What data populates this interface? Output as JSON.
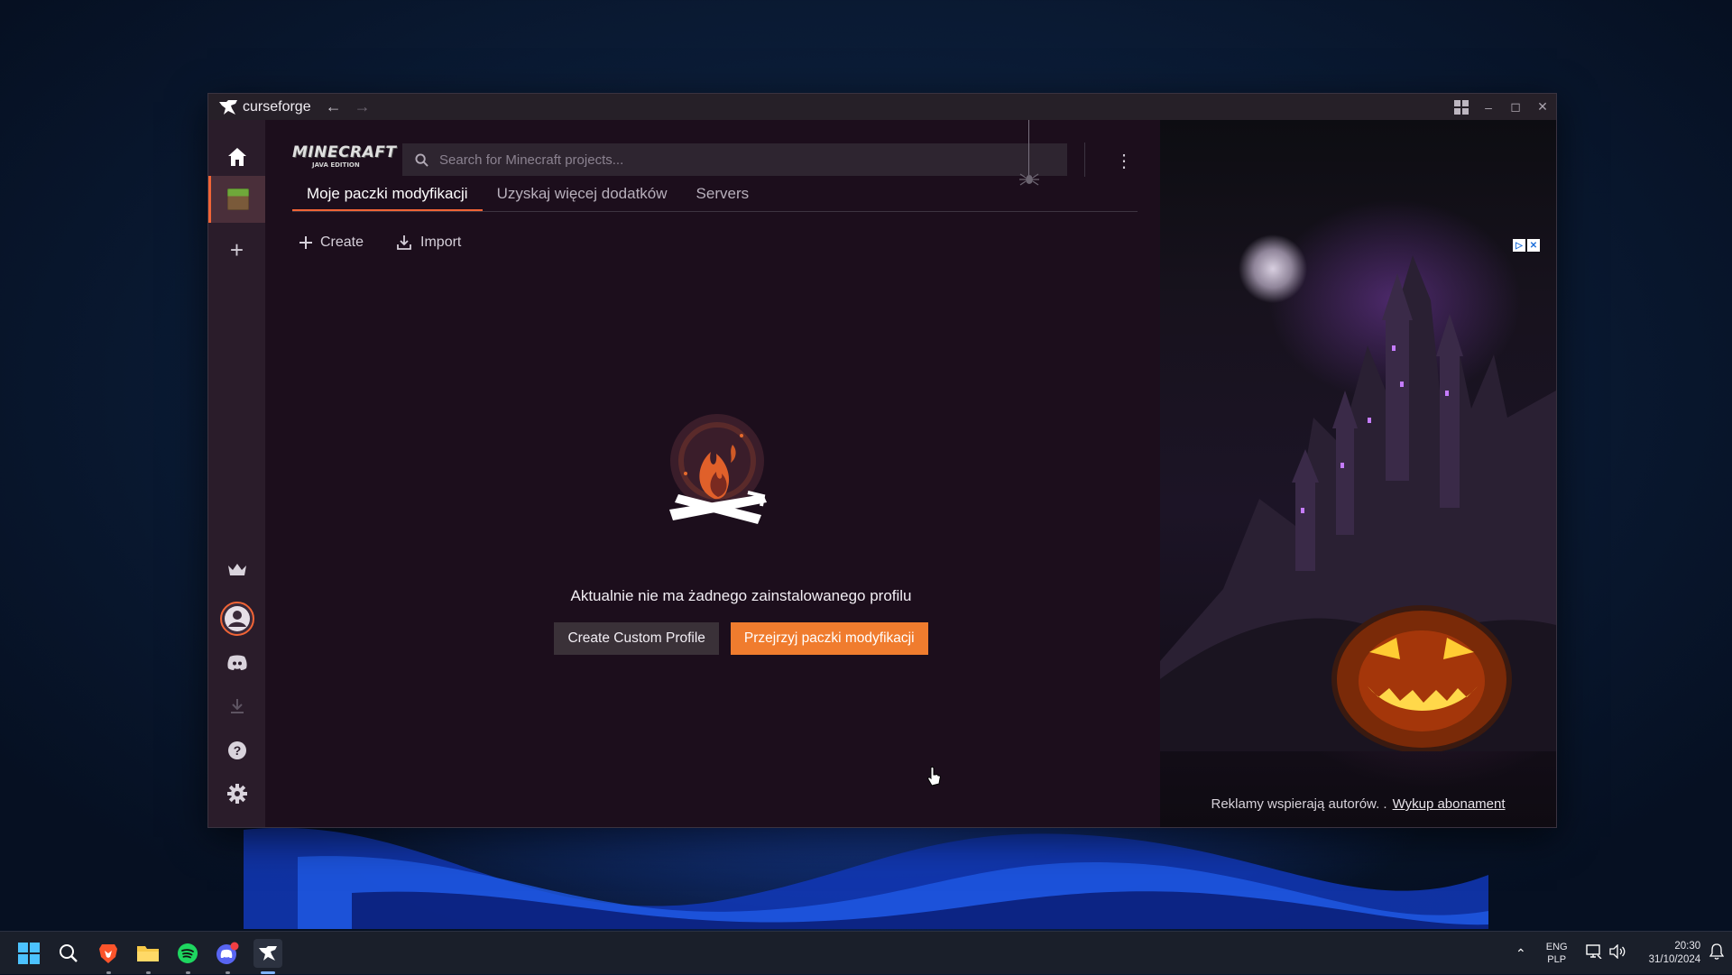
{
  "window": {
    "app_name": "curseforge",
    "back_icon": "arrow-left-icon",
    "forward_icon": "arrow-right-icon"
  },
  "header": {
    "game_logo_line1": "MINECRAFT",
    "game_logo_line2": "JAVA EDITION",
    "search_placeholder": "Search for Minecraft projects..."
  },
  "tabs": [
    {
      "label": "Moje paczki modyfikacji",
      "active": true
    },
    {
      "label": "Uzyskaj więcej dodatków",
      "active": false
    },
    {
      "label": "Servers",
      "active": false
    }
  ],
  "actions": {
    "create_label": "Create",
    "import_label": "Import"
  },
  "empty_state": {
    "message": "Aktualnie nie ma żadnego zainstalowanego profilu",
    "secondary_button": "Create Custom Profile",
    "primary_button": "Przejrzyj paczki modyfikacji"
  },
  "ad": {
    "footer_text": "Reklamy wspierają autorów. .",
    "footer_link": "Wykup abonament"
  },
  "taskbar": {
    "lang_line1": "ENG",
    "lang_line2": "PLP",
    "time": "20:30",
    "date": "31/10/2024"
  },
  "colors": {
    "accent": "#f16436",
    "primary_button": "#f07c2e",
    "window_bg": "#1c0e1c",
    "rail_bg": "#2a1c2a"
  }
}
